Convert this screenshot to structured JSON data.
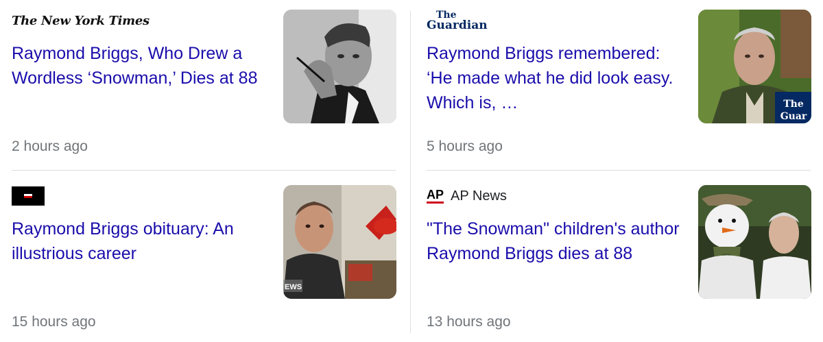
{
  "cards": [
    {
      "source_name": "The New York Times",
      "headline": "Raymond Briggs, Who Drew a Wordless ‘Snowman,’ Dies at 88",
      "time": "2 hours ago",
      "thumbnail_icon": "portrait-photo-bw"
    },
    {
      "source_name_line1": "The",
      "source_name_line2": "Guardian",
      "headline": "Raymond Briggs remembered: ‘He made what he did look easy. Which is, …",
      "time": "5 hours ago",
      "thumbnail_icon": "portrait-photo-color",
      "thumbnail_watermark_line1": "The",
      "thumbnail_watermark_line2": "Guar"
    },
    {
      "source_icon": "bbc-news-logo",
      "headline": "Raymond Briggs obituary: An illustrious career",
      "time": "15 hours ago",
      "thumbnail_icon": "artist-at-desk-photo",
      "thumbnail_watermark": "EWS"
    },
    {
      "source_logo": "AP",
      "source_name": "AP News",
      "headline": "\"The Snowman\" children's author Raymond Briggs dies at 88",
      "time": "13 hours ago",
      "thumbnail_icon": "snowman-costume-photo"
    }
  ],
  "colors": {
    "link": "#1a0dab",
    "meta": "#70757a",
    "divider": "#dadce0",
    "ap_red": "#d0021b"
  }
}
